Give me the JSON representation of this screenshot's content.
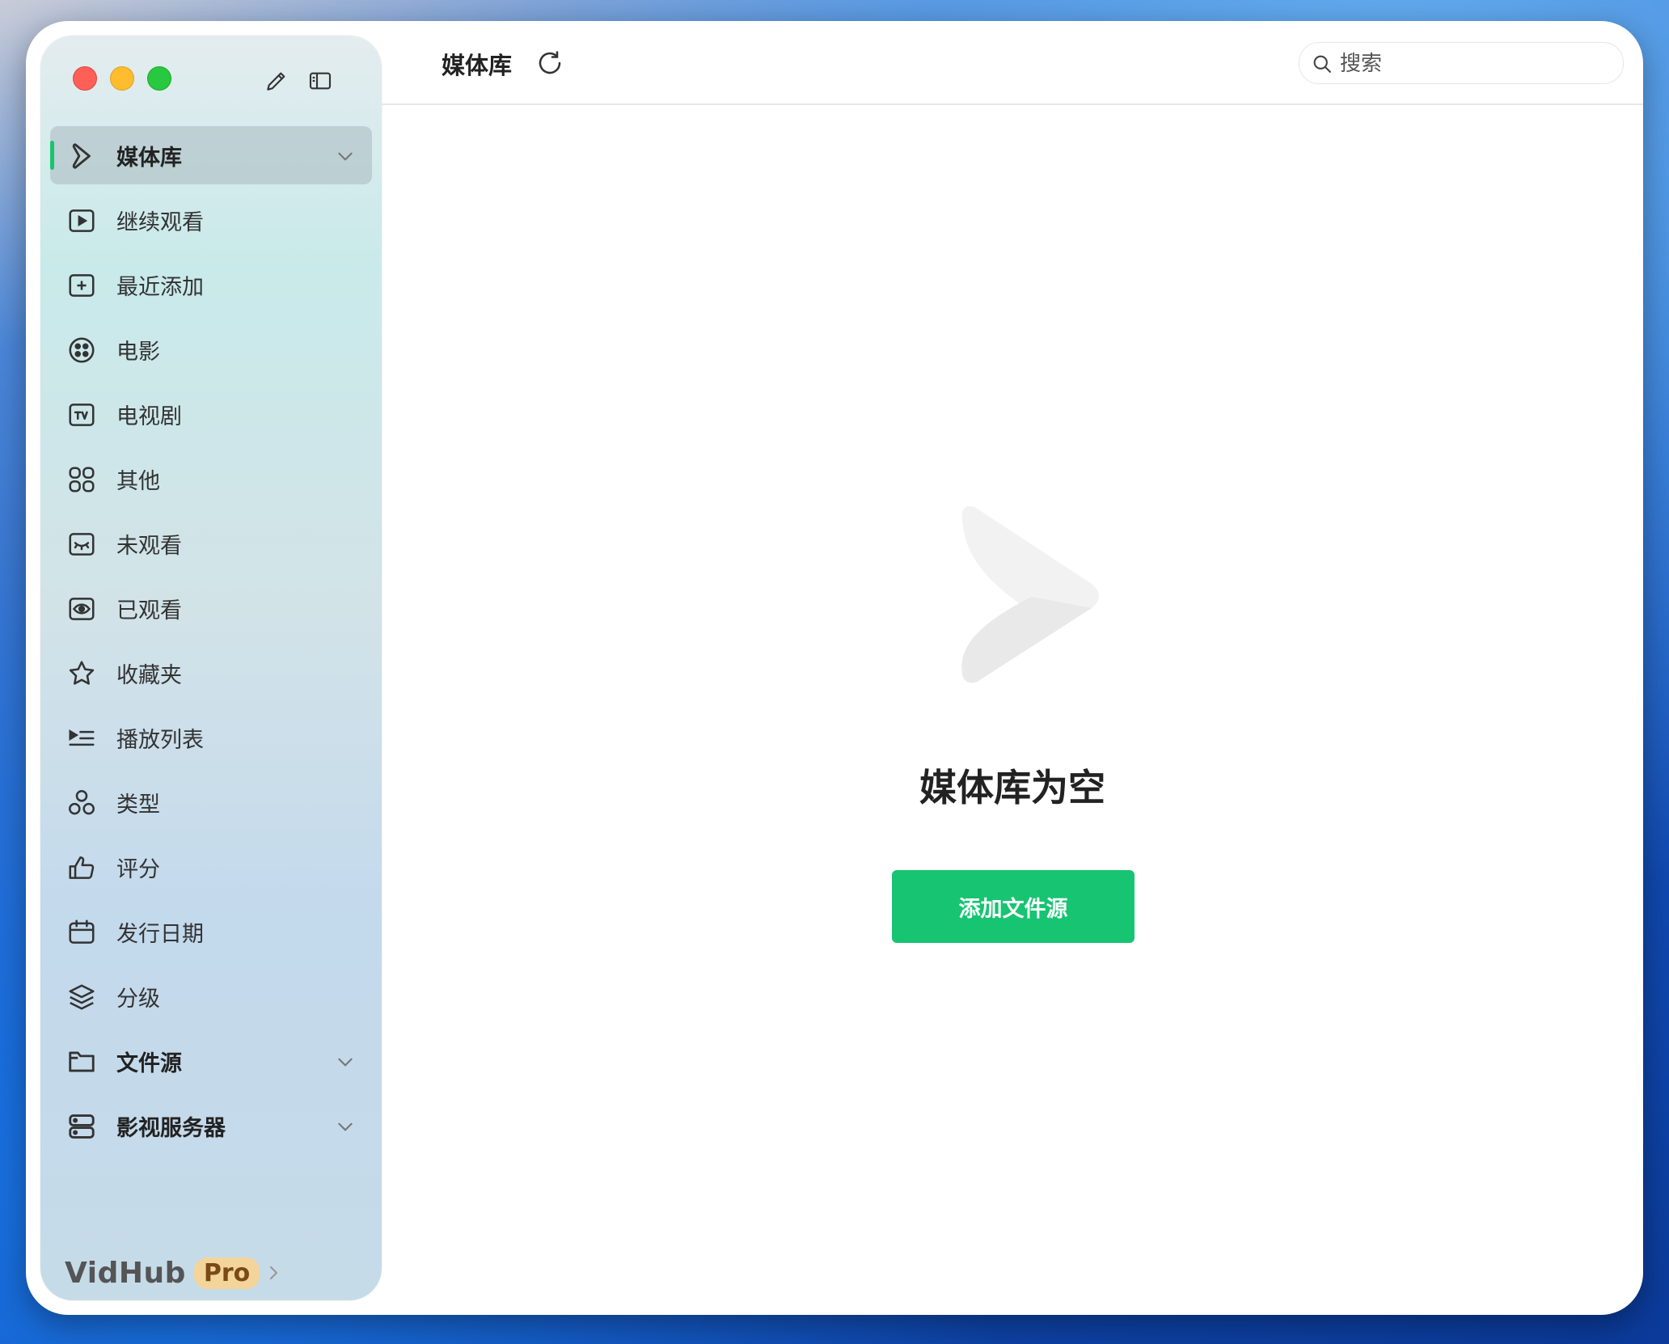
{
  "header": {
    "title": "媒体库",
    "search_placeholder": "搜索"
  },
  "sidebar": {
    "items": [
      {
        "label": "媒体库",
        "icon": "play-logo-icon"
      },
      {
        "label": "继续观看",
        "icon": "play-square-icon"
      },
      {
        "label": "最近添加",
        "icon": "plus-square-icon"
      },
      {
        "label": "电影",
        "icon": "film-reel-icon"
      },
      {
        "label": "电视剧",
        "icon": "tv-icon"
      },
      {
        "label": "其他",
        "icon": "grid-icon"
      },
      {
        "label": "未观看",
        "icon": "eye-closed-icon"
      },
      {
        "label": "已观看",
        "icon": "eye-icon"
      },
      {
        "label": "收藏夹",
        "icon": "star-icon"
      },
      {
        "label": "播放列表",
        "icon": "playlist-icon"
      },
      {
        "label": "类型",
        "icon": "shapes-icon"
      },
      {
        "label": "评分",
        "icon": "thumbs-up-icon"
      },
      {
        "label": "发行日期",
        "icon": "calendar-icon"
      },
      {
        "label": "分级",
        "icon": "layers-icon"
      },
      {
        "label": "文件源",
        "icon": "folder-icon"
      },
      {
        "label": "影视服务器",
        "icon": "server-icon"
      }
    ]
  },
  "brand": {
    "name": "VidHub",
    "badge": "Pro"
  },
  "main": {
    "empty_title": "媒体库为空",
    "add_button": "添加文件源"
  },
  "colors": {
    "accent": "#16c471",
    "active_indicator": "#18c46f",
    "pro_badge": "#f3d59b"
  }
}
